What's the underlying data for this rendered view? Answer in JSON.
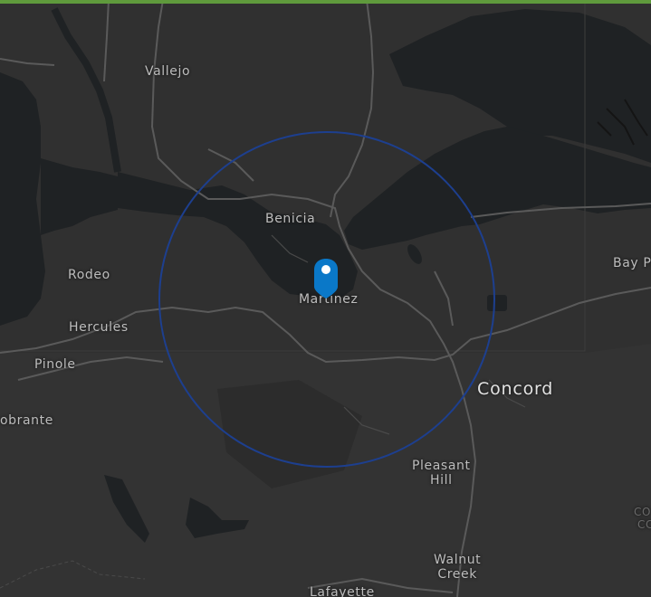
{
  "map": {
    "labels": {
      "vallejo": "Vallejo",
      "benicia": "Benicia",
      "rodeo": "Rodeo",
      "hercules": "Hercules",
      "pinole": "Pinole",
      "el_sobrante": "obrante",
      "martinez": "Martinez",
      "concord": "Concord",
      "pleasant_hill_1": "Pleasant",
      "pleasant_hill_2": "Hill",
      "walnut_creek_1": "Walnut",
      "walnut_creek_2": "Creek",
      "lafayette": "Lafayette",
      "bay_point": "Bay Po",
      "edge_fragment_1": "CO",
      "edge_fragment_2": "CC"
    },
    "marker": {
      "icon": "map-pin-icon",
      "color": "#0a78c8"
    },
    "radius_circle": {
      "color": "#1d3f8f"
    },
    "colors": {
      "land": "#303030",
      "water": "#1f2224",
      "roads": "#5a5a5a",
      "accent_bar": "#5f9a3c"
    }
  }
}
